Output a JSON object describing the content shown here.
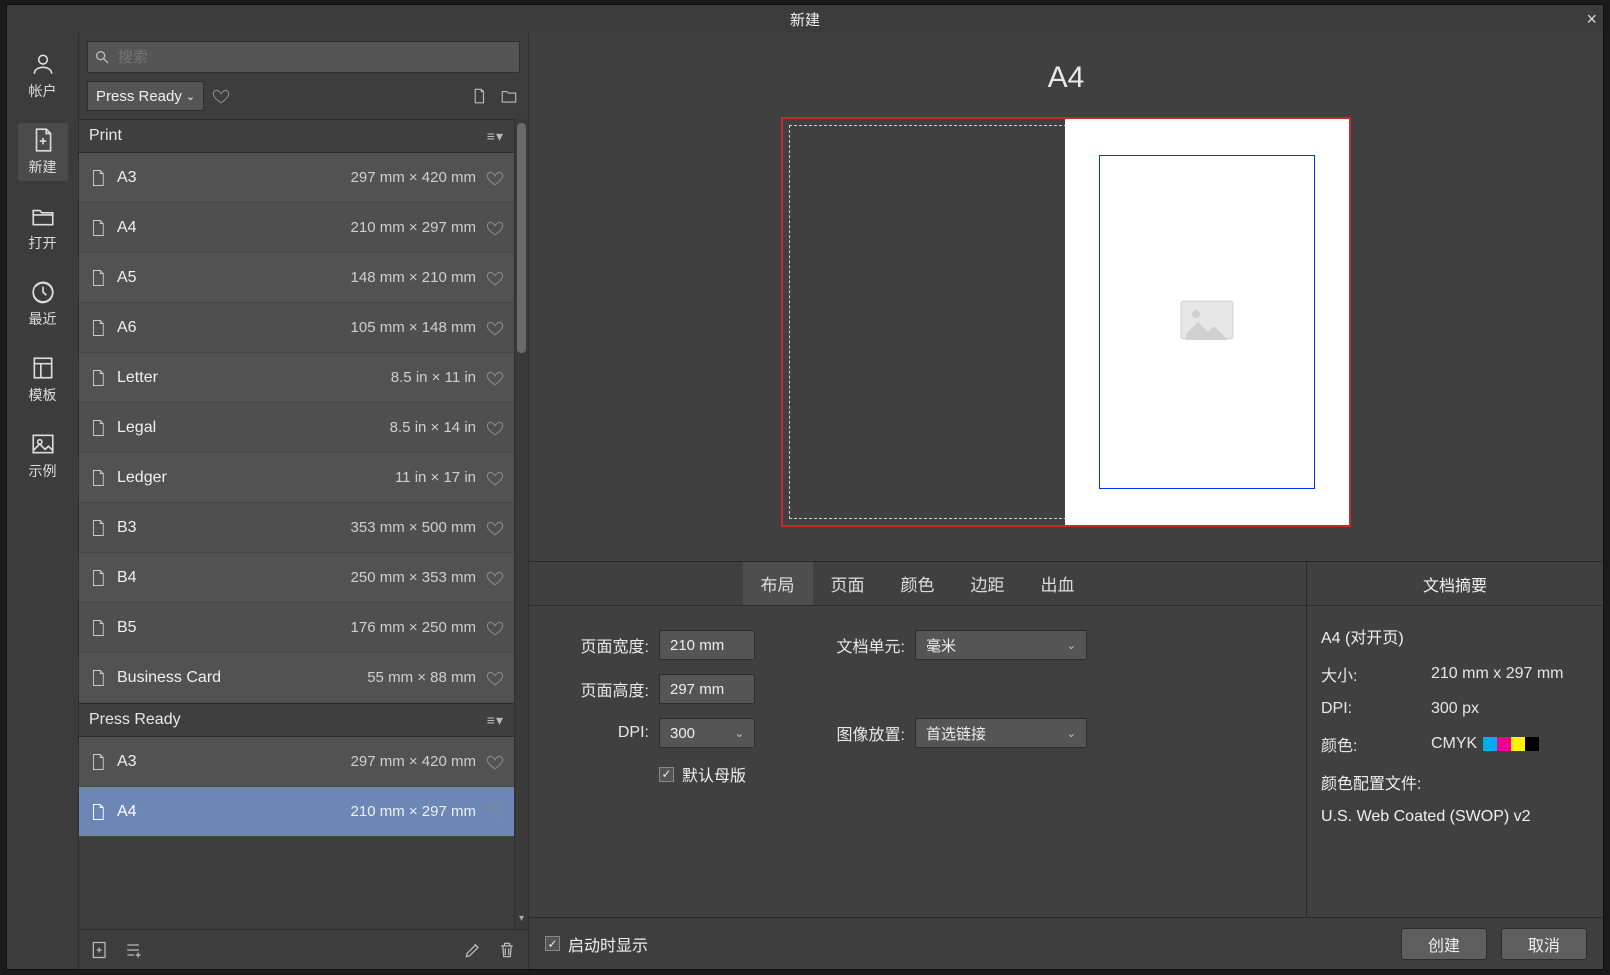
{
  "window": {
    "title": "新建"
  },
  "leftnav": {
    "items": [
      {
        "id": "account",
        "label": "帐户"
      },
      {
        "id": "new",
        "label": "新建"
      },
      {
        "id": "open",
        "label": "打开"
      },
      {
        "id": "recent",
        "label": "最近"
      },
      {
        "id": "template",
        "label": "模板"
      },
      {
        "id": "sample",
        "label": "示例"
      }
    ],
    "active": "new"
  },
  "search": {
    "placeholder": "搜索"
  },
  "filter": {
    "label": "Press Ready"
  },
  "groups": [
    {
      "name": "Print",
      "items": [
        {
          "name": "A3",
          "dim": "297 mm × 420 mm"
        },
        {
          "name": "A4",
          "dim": "210 mm × 297 mm"
        },
        {
          "name": "A5",
          "dim": "148 mm × 210 mm"
        },
        {
          "name": "A6",
          "dim": "105 mm × 148 mm"
        },
        {
          "name": "Letter",
          "dim": "8.5 in × 11 in"
        },
        {
          "name": "Legal",
          "dim": "8.5 in × 14 in"
        },
        {
          "name": "Ledger",
          "dim": "11 in × 17 in"
        },
        {
          "name": "B3",
          "dim": "353 mm × 500 mm"
        },
        {
          "name": "B4",
          "dim": "250 mm × 353 mm"
        },
        {
          "name": "B5",
          "dim": "176 mm × 250 mm"
        },
        {
          "name": "Business Card",
          "dim": "55 mm × 88 mm"
        }
      ]
    },
    {
      "name": "Press Ready",
      "items": [
        {
          "name": "A3",
          "dim": "297 mm × 420 mm"
        },
        {
          "name": "A4",
          "dim": "210 mm × 297 mm",
          "selected": true
        }
      ]
    }
  ],
  "preview": {
    "title": "A4"
  },
  "tabs": {
    "items": [
      "布局",
      "页面",
      "颜色",
      "边距",
      "出血"
    ],
    "active": 0
  },
  "props": {
    "pageWidthLabel": "页面宽度:",
    "pageWidth": "210 mm",
    "pageHeightLabel": "页面高度:",
    "pageHeight": "297 mm",
    "dpiLabel": "DPI:",
    "dpi": "300",
    "defaultMasterLabel": "默认母版",
    "defaultMasterChecked": true,
    "docUnitLabel": "文档单元:",
    "docUnit": "毫米",
    "imagePlaceLabel": "图像放置:",
    "imagePlace": "首选链接"
  },
  "summary": {
    "header": "文档摘要",
    "title": "A4 (对开页)",
    "sizeLabel": "大小:",
    "size": "210 mm  x  297 mm",
    "dpiLabel": "DPI:",
    "dpi": "300 px",
    "colorLabel": "颜色:",
    "color": "CMYK",
    "profileLabel": "颜色配置文件:",
    "profile": "U.S. Web Coated (SWOP) v2",
    "swatches": [
      "#00aeef",
      "#ec008c",
      "#fff200",
      "#000000"
    ]
  },
  "footer": {
    "showOnStart": "启动时显示",
    "create": "创建",
    "cancel": "取消"
  }
}
